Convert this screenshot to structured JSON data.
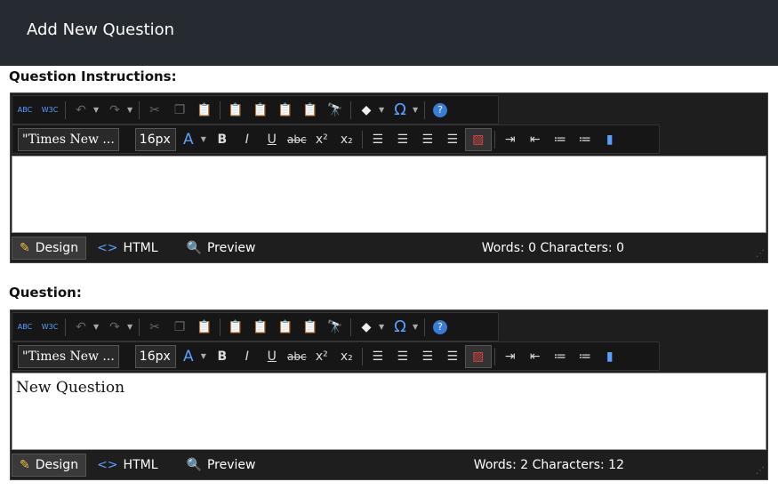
{
  "header": {
    "title": "Add New Question"
  },
  "editors": [
    {
      "label": "Question Instructions:",
      "font": "\"Times New ...",
      "size": "16px",
      "content": "",
      "modes": {
        "design": "Design",
        "html": "HTML",
        "preview": "Preview"
      },
      "status": "Words: 0   Characters: 0"
    },
    {
      "label": "Question:",
      "font": "\"Times New ...",
      "size": "16px",
      "content": "New Question",
      "modes": {
        "design": "Design",
        "html": "HTML",
        "preview": "Preview"
      },
      "status": "Words: 2   Characters: 12"
    }
  ],
  "toolbar_icons": {
    "spell": "ABC",
    "w3c": "W3C",
    "omega": "Ω",
    "help": "?",
    "font_color": "A",
    "bold": "B",
    "italic": "I",
    "underline": "U",
    "strike": "abc",
    "sup": "x²",
    "sub": "x₂"
  }
}
